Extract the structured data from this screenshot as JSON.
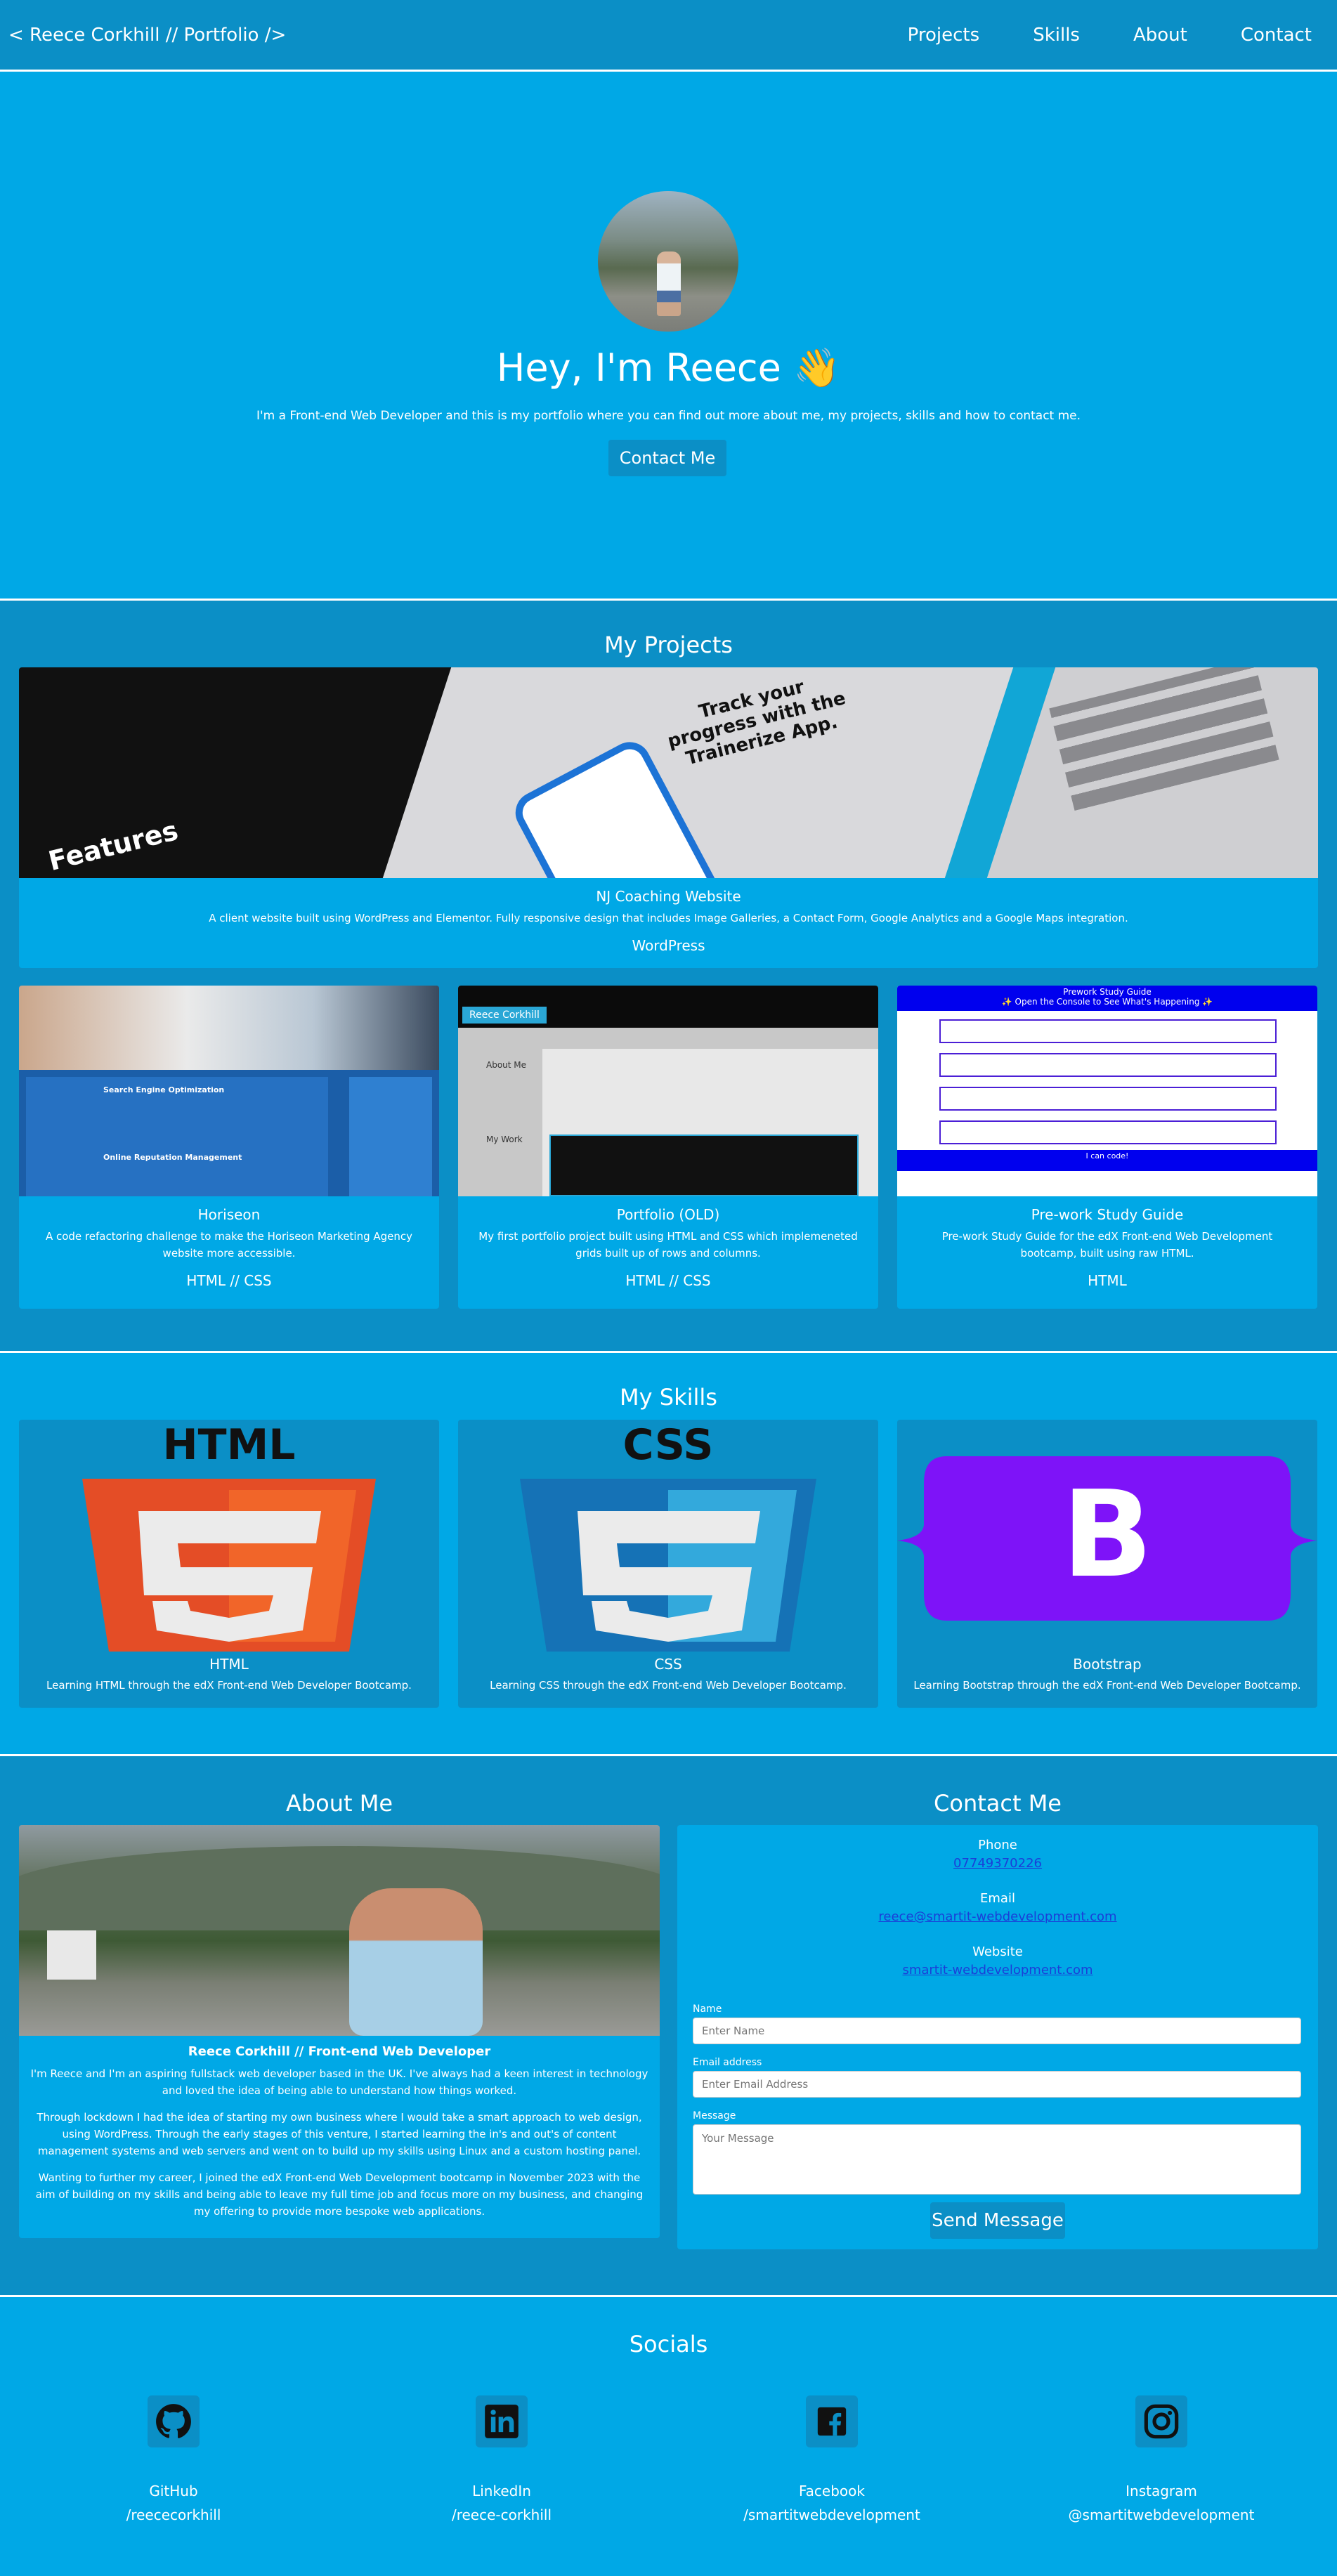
{
  "nav": {
    "brand": "< Reece Corkhill // Portfolio />",
    "links": [
      "Projects",
      "Skills",
      "About",
      "Contact"
    ]
  },
  "hero": {
    "title": "Hey, I'm Reece 👋",
    "subtitle": "I'm a Front-end Web Developer and this is my portfolio where you can find out more about me, my projects, skills and how to contact me.",
    "button": "Contact Me"
  },
  "projects": {
    "title": "My Projects",
    "featured": {
      "name": "NJ Coaching Website",
      "description": "A client website built using WordPress and Elementor. Fully responsive design that includes Image Galleries, a Contact Form, Google Analytics and a Google Maps integration.",
      "tech": "WordPress",
      "image_text": {
        "features": "Features",
        "headline": "Track your progress with the Trainerize App."
      }
    },
    "items": [
      {
        "name": "Horiseon",
        "description": "A code refactoring challenge to make the Horiseon Marketing Agency website more accessible.",
        "tech": "HTML // CSS",
        "image_text": [
          "Search Engine Optimization",
          "Online Reputation Management"
        ]
      },
      {
        "name": "Portfolio (OLD)",
        "description": "My first portfolio project built using HTML and CSS which implemeneted grids built up of rows and columns.",
        "tech": "HTML // CSS",
        "image_text": [
          "Reece Corkhill",
          "About Me",
          "My Work"
        ]
      },
      {
        "name": "Pre-work Study Guide",
        "description": "Pre-work Study Guide for the edX Front-end Web Development bootcamp, built using raw HTML.",
        "tech": "HTML",
        "image_text": [
          "Prework Study Guide",
          "✨ Open the Console to See What's Happening ✨",
          "I can code!"
        ]
      }
    ]
  },
  "skills": {
    "title": "My Skills",
    "items": [
      {
        "name": "HTML",
        "description": "Learning HTML through the edX Front-end Web Developer Bootcamp.",
        "icon": "html5-logo",
        "caption": "HTML"
      },
      {
        "name": "CSS",
        "description": "Learning CSS through the edX Front-end Web Developer Bootcamp.",
        "icon": "css3-logo",
        "caption": "CSS"
      },
      {
        "name": "Bootstrap",
        "description": "Learning Bootstrap through the edX Front-end Web Developer Bootcamp.",
        "icon": "bootstrap-logo",
        "caption": "B"
      }
    ]
  },
  "about": {
    "title": "About Me",
    "name": "Reece Corkhill // Front-end Web Developer",
    "paragraphs": [
      "I'm Reece and I'm an aspiring fullstack web developer based in the UK. I've always had a keen interest in technology and loved the idea of being able to understand how things worked.",
      "Through lockdown I had the idea of starting my own business where I would take a smart approach to web design, using WordPress. Through the early stages of this venture, I started learning the in's and out's of content management systems and web servers and went on to build up my skills using Linux and a custom hosting panel.",
      "Wanting to further my career, I joined the edX Front-end Web Development bootcamp in November 2023 with the aim of building on my skills and being able to leave my full time job and focus more on my business, and changing my offering to provide more bespoke web applications."
    ]
  },
  "contact": {
    "title": "Contact Me",
    "phone_label": "Phone",
    "phone": "07749370226",
    "email_label": "Email",
    "email": "reece@smartit-webdevelopment.com",
    "website_label": "Website",
    "website": "smartit-webdevelopment.com",
    "form": {
      "name_label": "Name",
      "name_placeholder": "Enter Name",
      "email_label": "Email address",
      "email_placeholder": "Enter Email Address",
      "message_label": "Message",
      "message_placeholder": "Your Message",
      "submit": "Send Message"
    }
  },
  "socials": {
    "title": "Socials",
    "items": [
      {
        "name": "GitHub",
        "handle": "/reececorkhill",
        "icon": "github-icon"
      },
      {
        "name": "LinkedIn",
        "handle": "/reece-corkhill",
        "icon": "linkedin-icon"
      },
      {
        "name": "Facebook",
        "handle": "/smartitwebdevelopment",
        "icon": "facebook-icon"
      },
      {
        "name": "Instagram",
        "handle": "@smartitwebdevelopment",
        "icon": "instagram-icon"
      }
    ]
  },
  "colors": {
    "primary": "#00a8e6",
    "secondary": "#0b8fc6",
    "link": "#1a3fd8"
  }
}
